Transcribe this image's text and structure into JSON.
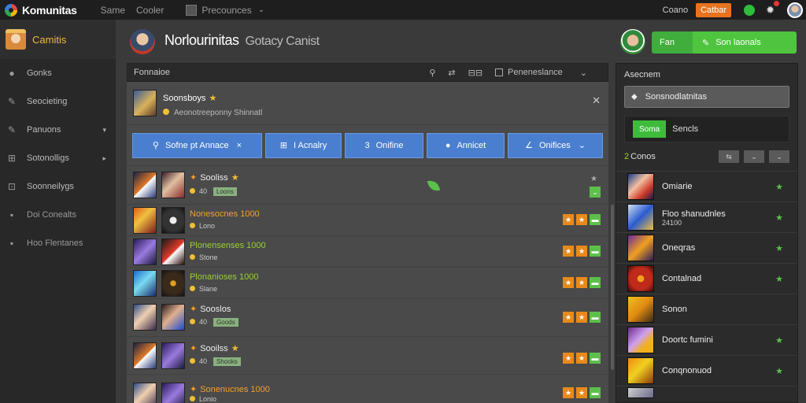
{
  "topbar": {
    "brand": "Komunitas",
    "nav": [
      "Same",
      "Cooler"
    ],
    "selector": "Precounces",
    "right_text": "Coano",
    "right_button": "Catbar"
  },
  "sidebar": {
    "header": "Camitis",
    "items": [
      {
        "label": "Gonks",
        "icon": "●"
      },
      {
        "label": "Seocieting",
        "icon": "✎"
      },
      {
        "label": "Panuons",
        "icon": "✎",
        "arrow": "▾"
      },
      {
        "label": "Sotonolligs",
        "icon": "⊞",
        "arrow": "▸"
      },
      {
        "label": "Soonneilygs",
        "icon": "⊡"
      },
      {
        "label": "Doi Conealts",
        "icon": "▪"
      },
      {
        "label": "Hoo Flentanes",
        "icon": "▪"
      }
    ]
  },
  "main_header": {
    "title": "Norlourinitas",
    "subtitle": "Gotacy Canist",
    "btn_left": "Fan",
    "btn_right": "Son laonals"
  },
  "toolbar": {
    "title": "Fonnaioe",
    "icons": [
      "⚲",
      "⇄",
      "⊟⊟"
    ],
    "selector": "Peneneslance"
  },
  "group": {
    "title": "Soonsboys",
    "subtitle": "Aeonotreeponny Shinnatl"
  },
  "filters": [
    {
      "icon": "⚲",
      "label": "Sofne pt Annace",
      "x": "×"
    },
    {
      "icon": "⊞",
      "label": "I Acnalry",
      "x": ""
    },
    {
      "icon": "3",
      "label": "Onifine",
      "x": ""
    },
    {
      "icon": "●",
      "label": "Annicet",
      "x": ""
    },
    {
      "icon": "∠",
      "label": "Onifices",
      "x": "⌄"
    }
  ],
  "rows": [
    {
      "title": "Sooliss",
      "sub": "40",
      "tag": "Loons",
      "color": "white"
    },
    {
      "title": "Nonesocnes 1000",
      "sub": "Lono",
      "tag": "",
      "color": "orange"
    },
    {
      "title": "Plonensenses 1000",
      "sub": "Stone",
      "tag": "",
      "color": "green"
    },
    {
      "title": "Plonanioses 1000",
      "sub": "Slane",
      "tag": "",
      "color": "green"
    },
    {
      "title": "Sooslos",
      "sub": "40",
      "tag": "Goods",
      "color": "white"
    },
    {
      "title": "Sooilss",
      "sub": "40",
      "tag": "Shooks",
      "color": "white"
    },
    {
      "title": "Sonenucnes 1000",
      "sub": "Lonio",
      "tag": "",
      "color": "orange"
    }
  ],
  "right_panel": {
    "header": "Asecnem",
    "input": "Sonsnodlatnitas",
    "tab_on": "Soma",
    "tab_off": "Sencls",
    "subhead_num": "2",
    "subhead_text": "Conos",
    "friends": [
      {
        "name": "Omiarie",
        "sub": ""
      },
      {
        "name": "Floo shanudnles",
        "sub": "24100"
      },
      {
        "name": "Oneqras",
        "sub": ""
      },
      {
        "name": "Contalnad",
        "sub": ""
      },
      {
        "name": "Sonon",
        "sub": ""
      },
      {
        "name": "Doortc fumini",
        "sub": ""
      },
      {
        "name": "Conqnonuod",
        "sub": ""
      }
    ]
  }
}
